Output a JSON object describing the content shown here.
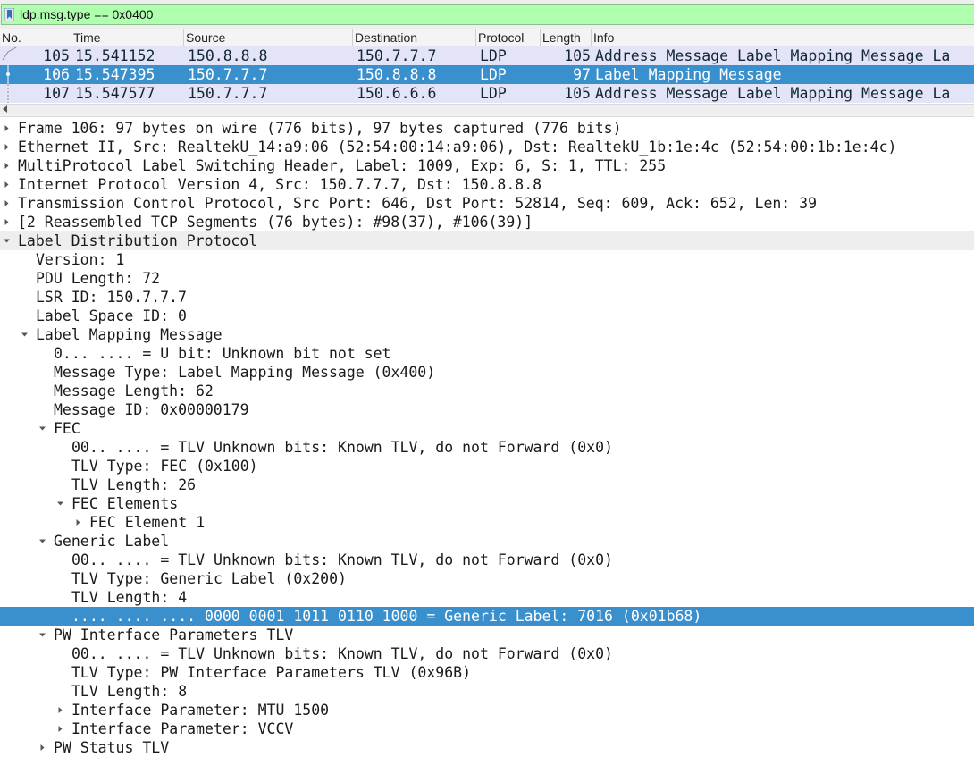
{
  "filter": {
    "text": "ldp.msg.type == 0x0400",
    "icon": "bookmark-icon",
    "color": "#afffaf"
  },
  "packet_list": {
    "columns": [
      "No.",
      "Time",
      "Source",
      "Destination",
      "Protocol",
      "Length",
      "Info"
    ],
    "rows": [
      {
        "no": "105",
        "time": "15.541152",
        "source": "150.8.8.8",
        "destination": "150.7.7.7",
        "protocol": "LDP",
        "length": "105",
        "info": "Address Message Label Mapping Message La"
      },
      {
        "no": "106",
        "time": "15.547395",
        "source": "150.7.7.7",
        "destination": "150.8.8.8",
        "protocol": "LDP",
        "length": "97",
        "info": "Label Mapping Message",
        "selected": true
      },
      {
        "no": "107",
        "time": "15.547577",
        "source": "150.7.7.7",
        "destination": "150.6.6.6",
        "protocol": "LDP",
        "length": "105",
        "info": "Address Message Label Mapping Message La"
      }
    ],
    "row_color": "#e4e4f9",
    "selected_color": "#3a8fcd"
  },
  "details": [
    {
      "text": "Frame 106: 97 bytes on wire (776 bits), 97 bytes captured (776 bits)",
      "level": 0,
      "arrow": "collapsed"
    },
    {
      "text": "Ethernet II, Src: RealtekU_14:a9:06 (52:54:00:14:a9:06), Dst: RealtekU_1b:1e:4c (52:54:00:1b:1e:4c)",
      "level": 0,
      "arrow": "collapsed"
    },
    {
      "text": "MultiProtocol Label Switching Header, Label: 1009, Exp: 6, S: 1, TTL: 255",
      "level": 0,
      "arrow": "collapsed"
    },
    {
      "text": "Internet Protocol Version 4, Src: 150.7.7.7, Dst: 150.8.8.8",
      "level": 0,
      "arrow": "collapsed"
    },
    {
      "text": "Transmission Control Protocol, Src Port: 646, Dst Port: 52814, Seq: 609, Ack: 652, Len: 39",
      "level": 0,
      "arrow": "collapsed"
    },
    {
      "text": "[2 Reassembled TCP Segments (76 bytes): #98(37), #106(39)]",
      "level": 0,
      "arrow": "collapsed"
    },
    {
      "text": "Label Distribution Protocol",
      "level": 0,
      "arrow": "expanded",
      "alt": true
    },
    {
      "text": "Version: 1",
      "level": 1,
      "arrow": "none"
    },
    {
      "text": "PDU Length: 72",
      "level": 1,
      "arrow": "none"
    },
    {
      "text": "LSR ID: 150.7.7.7",
      "level": 1,
      "arrow": "none"
    },
    {
      "text": "Label Space ID: 0",
      "level": 1,
      "arrow": "none"
    },
    {
      "text": "Label Mapping Message",
      "level": 1,
      "arrow": "expanded"
    },
    {
      "text": "0... .... = U bit: Unknown bit not set",
      "level": 2,
      "arrow": "none"
    },
    {
      "text": "Message Type: Label Mapping Message (0x400)",
      "level": 2,
      "arrow": "none"
    },
    {
      "text": "Message Length: 62",
      "level": 2,
      "arrow": "none"
    },
    {
      "text": "Message ID: 0x00000179",
      "level": 2,
      "arrow": "none"
    },
    {
      "text": "FEC",
      "level": 2,
      "arrow": "expanded"
    },
    {
      "text": "00.. .... = TLV Unknown bits: Known TLV, do not Forward (0x0)",
      "level": 3,
      "arrow": "none"
    },
    {
      "text": "TLV Type: FEC (0x100)",
      "level": 3,
      "arrow": "none"
    },
    {
      "text": "TLV Length: 26",
      "level": 3,
      "arrow": "none"
    },
    {
      "text": "FEC Elements",
      "level": 3,
      "arrow": "expanded"
    },
    {
      "text": "FEC Element 1",
      "level": 4,
      "arrow": "collapsed"
    },
    {
      "text": "Generic Label",
      "level": 2,
      "arrow": "expanded"
    },
    {
      "text": "00.. .... = TLV Unknown bits: Known TLV, do not Forward (0x0)",
      "level": 3,
      "arrow": "none"
    },
    {
      "text": "TLV Type: Generic Label (0x200)",
      "level": 3,
      "arrow": "none"
    },
    {
      "text": "TLV Length: 4",
      "level": 3,
      "arrow": "none"
    },
    {
      "text": ".... .... .... 0000 0001 1011 0110 1000 = Generic Label: 7016 (0x01b68)",
      "level": 3,
      "arrow": "none",
      "selected": true
    },
    {
      "text": "PW Interface Parameters TLV",
      "level": 2,
      "arrow": "expanded"
    },
    {
      "text": "00.. .... = TLV Unknown bits: Known TLV, do not Forward (0x0)",
      "level": 3,
      "arrow": "none"
    },
    {
      "text": "TLV Type: PW Interface Parameters TLV (0x96B)",
      "level": 3,
      "arrow": "none"
    },
    {
      "text": "TLV Length: 8",
      "level": 3,
      "arrow": "none"
    },
    {
      "text": "Interface Parameter: MTU 1500",
      "level": 3,
      "arrow": "collapsed"
    },
    {
      "text": "Interface Parameter: VCCV",
      "level": 3,
      "arrow": "collapsed"
    },
    {
      "text": "PW Status TLV",
      "level": 2,
      "arrow": "collapsed"
    }
  ]
}
